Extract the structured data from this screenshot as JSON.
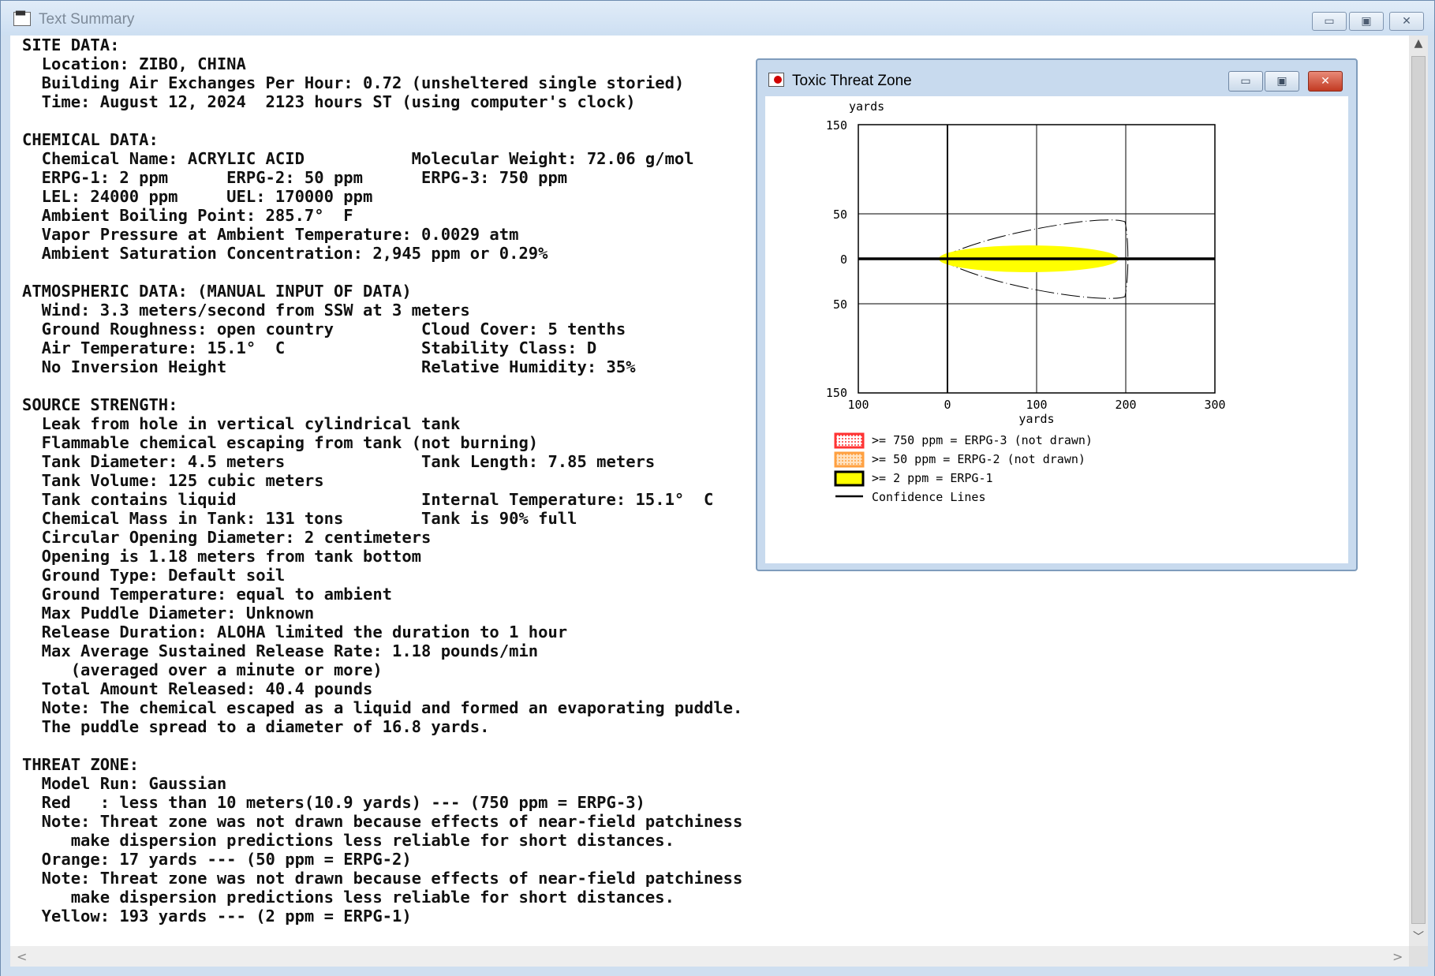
{
  "main_window": {
    "title": "Text Summary",
    "buttons": {
      "minimize": "▭",
      "maximize": "▣",
      "close": "✕"
    },
    "summary_text": "SITE DATA:\n  Location: ZIBO, CHINA\n  Building Air Exchanges Per Hour: 0.72 (unsheltered single storied)\n  Time: August 12, 2024  2123 hours ST (using computer's clock)\n\nCHEMICAL DATA:\n  Chemical Name: ACRYLIC ACID           Molecular Weight: 72.06 g/mol\n  ERPG-1: 2 ppm      ERPG-2: 50 ppm      ERPG-3: 750 ppm\n  LEL: 24000 ppm     UEL: 170000 ppm\n  Ambient Boiling Point: 285.7°  F\n  Vapor Pressure at Ambient Temperature: 0.0029 atm\n  Ambient Saturation Concentration: 2,945 ppm or 0.29%\n\nATMOSPHERIC DATA: (MANUAL INPUT OF DATA)\n  Wind: 3.3 meters/second from SSW at 3 meters\n  Ground Roughness: open country         Cloud Cover: 5 tenths\n  Air Temperature: 15.1°  C              Stability Class: D\n  No Inversion Height                    Relative Humidity: 35%\n\nSOURCE STRENGTH:\n  Leak from hole in vertical cylindrical tank\n  Flammable chemical escaping from tank (not burning)\n  Tank Diameter: 4.5 meters              Tank Length: 7.85 meters\n  Tank Volume: 125 cubic meters\n  Tank contains liquid                   Internal Temperature: 15.1°  C\n  Chemical Mass in Tank: 131 tons        Tank is 90% full\n  Circular Opening Diameter: 2 centimeters\n  Opening is 1.18 meters from tank bottom\n  Ground Type: Default soil\n  Ground Temperature: equal to ambient\n  Max Puddle Diameter: Unknown\n  Release Duration: ALOHA limited the duration to 1 hour\n  Max Average Sustained Release Rate: 1.18 pounds/min\n     (averaged over a minute or more)\n  Total Amount Released: 40.4 pounds\n  Note: The chemical escaped as a liquid and formed an evaporating puddle.\n  The puddle spread to a diameter of 16.8 yards.\n\nTHREAT ZONE:\n  Model Run: Gaussian\n  Red   : less than 10 meters(10.9 yards) --- (750 ppm = ERPG-3)\n  Note: Threat zone was not drawn because effects of near-field patchiness\n     make dispersion predictions less reliable for short distances.\n  Orange: 17 yards --- (50 ppm = ERPG-2)\n  Note: Threat zone was not drawn because effects of near-field patchiness\n     make dispersion predictions less reliable for short distances.\n  Yellow: 193 yards --- (2 ppm = ERPG-1)"
  },
  "scrollbars": {
    "up": "▲",
    "down": "﹀",
    "left": "<",
    "right": ">"
  },
  "threat_window": {
    "title": "Toxic Threat Zone",
    "buttons": {
      "minimize": "▭",
      "maximize": "▣",
      "close": "✕"
    },
    "plot": {
      "y_unit_label": "yards",
      "x_unit_label": "yards",
      "y_tick_labels": [
        "150",
        "50",
        "0",
        "50",
        "150"
      ],
      "x_tick_labels": [
        "100",
        "0",
        "100",
        "200",
        "300"
      ],
      "x_range": [
        -100,
        300
      ],
      "y_range": [
        -150,
        150
      ],
      "threat_zone_end_yards": 193
    },
    "legend": [
      {
        "label": ">= 750 ppm = ERPG-3 (not drawn)",
        "color": "#ff3333",
        "style": "dotted-fill"
      },
      {
        "label": ">= 50 ppm = ERPG-2 (not drawn)",
        "color": "#ffa040",
        "style": "dotted-fill"
      },
      {
        "label": ">= 2 ppm = ERPG-1",
        "color": "#ffff00",
        "style": "solid"
      },
      {
        "label": "Confidence Lines",
        "color": "#000000",
        "style": "line"
      }
    ]
  }
}
